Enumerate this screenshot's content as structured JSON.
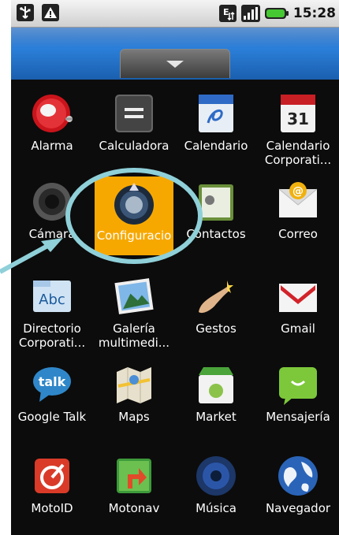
{
  "status_bar": {
    "time": "15:28"
  },
  "apps": [
    {
      "label": "Alarma",
      "icon": "alarm-clock-icon"
    },
    {
      "label": "Calculadora",
      "icon": "calculator-icon"
    },
    {
      "label": "Calendario",
      "icon": "calendar-icon"
    },
    {
      "label": "Calendario Corporati...",
      "icon": "corporate-calendar-icon",
      "date": "31"
    },
    {
      "label": "Cámara",
      "icon": "camera-icon"
    },
    {
      "label": "Configuracio",
      "icon": "settings-icon"
    },
    {
      "label": "Contactos",
      "icon": "contacts-icon"
    },
    {
      "label": "Correo",
      "icon": "email-icon"
    },
    {
      "label": "Directorio Corporati...",
      "icon": "directory-icon",
      "badge": "Abc"
    },
    {
      "label": "Galería multimedi...",
      "icon": "gallery-icon"
    },
    {
      "label": "Gestos",
      "icon": "gestures-icon"
    },
    {
      "label": "Gmail",
      "icon": "gmail-icon"
    },
    {
      "label": "Google Talk",
      "icon": "google-talk-icon",
      "badge": "talk"
    },
    {
      "label": "Maps",
      "icon": "maps-icon"
    },
    {
      "label": "Market",
      "icon": "market-icon"
    },
    {
      "label": "Mensajería",
      "icon": "messaging-icon"
    },
    {
      "label": "MotoID",
      "icon": "motoid-icon"
    },
    {
      "label": "Motonav",
      "icon": "motonav-icon"
    },
    {
      "label": "Música",
      "icon": "music-icon"
    },
    {
      "label": "Navegador",
      "icon": "browser-icon"
    }
  ],
  "colors": {
    "highlight": "#f7a800",
    "annotation": "#8fd0d9",
    "header": "#1a5fae"
  }
}
